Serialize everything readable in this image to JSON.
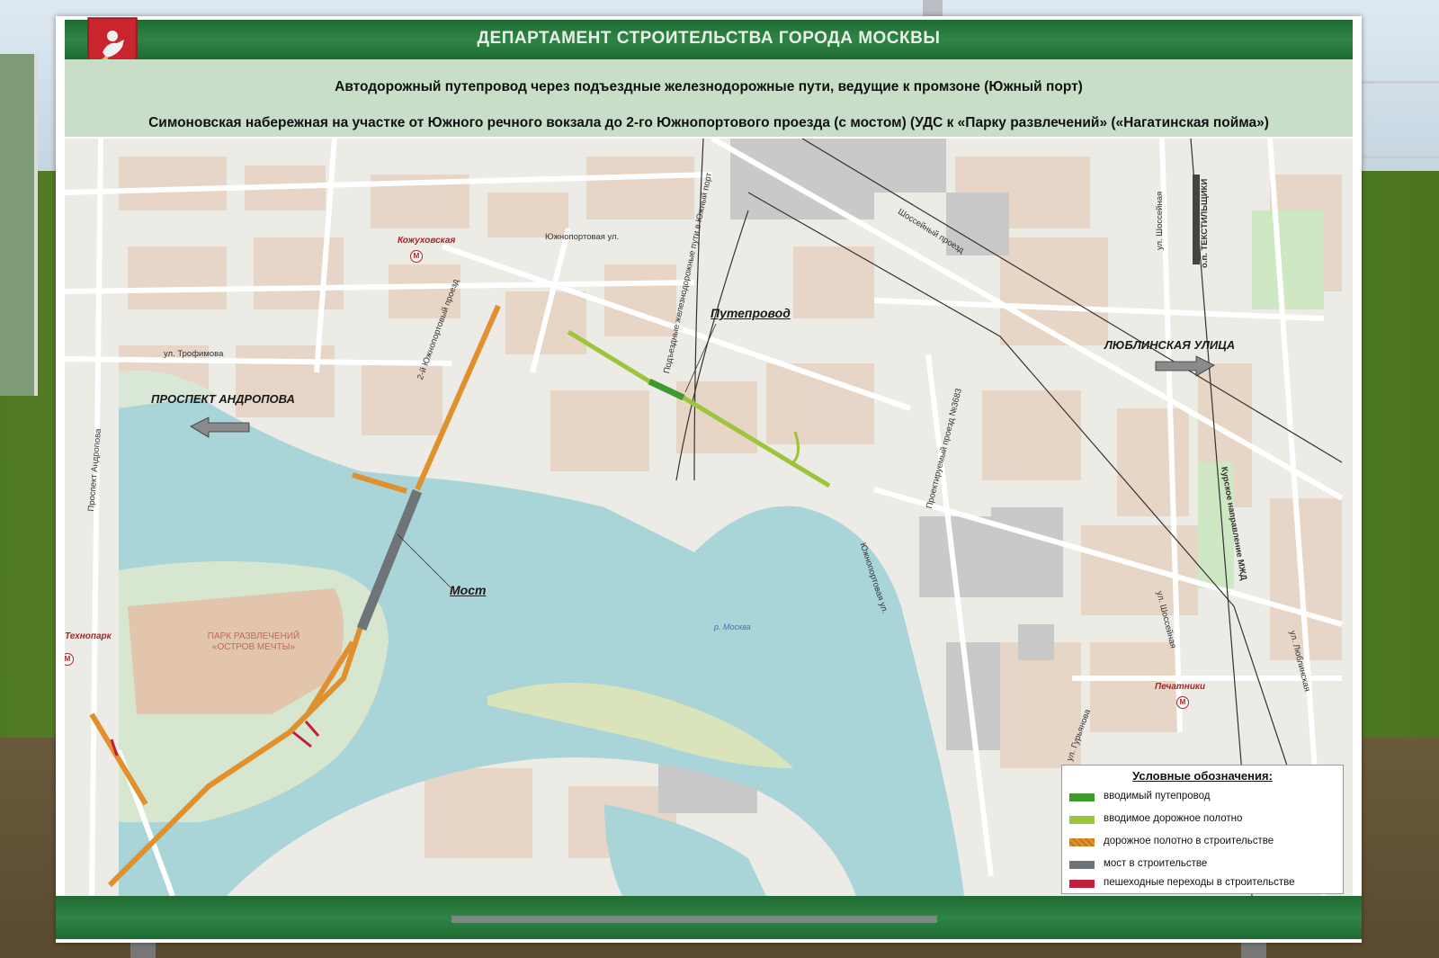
{
  "header": {
    "department": "ДЕПАРТАМЕНТ СТРОИТЕЛЬСТВА ГОРОДА МОСКВЫ",
    "subtitle_1": "Автодорожный путепровод через подъездные железнодорожные пути, ведущие к промзоне (Южный порт)",
    "subtitle_2": "Симоновская набережная на участке от Южного речного вокзала до 2-го Южнопортового проезда (с мостом) (УДС к «Парку развлечений» («Нагатинская пойма»)"
  },
  "map": {
    "callouts": {
      "overpass": "Путепровод",
      "bridge": "Мост",
      "prospekt_andropova": "ПРОСПЕКТ АНДРОПОВА",
      "lyublinskaya": "ЛЮБЛИНСКАЯ УЛИЦА"
    },
    "metro": {
      "kozhukhovskaya": "Кожуховская",
      "tekhnopark": "Технопарк",
      "pechatniki": "Печатники",
      "symbol": "М"
    },
    "streets": {
      "yuzhnoportovaya_top": "Южнопортовая ул.",
      "trofimova": "ул. Трофимова",
      "second_yuzhnoportovy": "2-й Южнопортовый проезд",
      "prospekt_andropova_v": "Проспект Андропова",
      "rail_access": "Подъездные железнодорожные пути в Южный порт",
      "shosseyny": "Шоссейный проезд",
      "proektiruemy": "Проектируемый проезд №3683",
      "yuzhnoportovaya_side": "Южнопортовая ул.",
      "shosseynaya_top": "ул. Шоссейная",
      "shosseynaya_bottom": "ул. Шоссейная",
      "o_p_tekstilshchiki": "о.п. ТЕКСТИЛЬЩИКИ",
      "kurskoe": "Курское направление МЖД",
      "lyublinskaya_v": "ул. Люблинская",
      "guryanova": "ул. Гурьянова",
      "river": "р. Москва",
      "park": "ПАРК РАЗВЛЕЧЕНИЙ «ОСТРОВ МЕЧТЫ»"
    }
  },
  "legend": {
    "title": "Условные обозначения:",
    "items": [
      {
        "label": "вводимый путепровод",
        "color": "#3f9a2e"
      },
      {
        "label": "вводимое дорожное полотно",
        "color": "#9dc43a"
      },
      {
        "label": "дорожное полотно в строительстве",
        "color": "#e0902c"
      },
      {
        "label": "мост в строительстве",
        "color": "#6f7479"
      },
      {
        "label": "пешеходные переходы в строительстве",
        "color": "#c21e3c"
      }
    ]
  },
  "colors": {
    "header_green": "#2f8445",
    "subheader_green": "#c9dec9",
    "water": "#a9d4d8",
    "park_land": "#e3c4ad",
    "green_space": "#bfe0b3"
  }
}
